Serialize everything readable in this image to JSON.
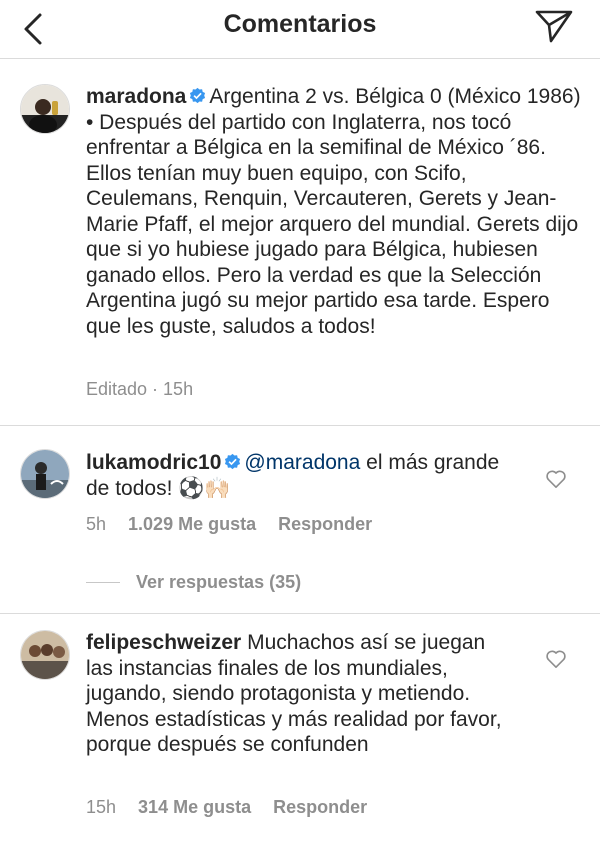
{
  "header": {
    "title": "Comentarios"
  },
  "caption": {
    "username": "maradona",
    "text": "Argentina 2 vs. Bélgica 0 (México 1986) • Después del partido con Inglaterra, nos tocó enfrentar a Bélgica en la semifinal de México ´86. Ellos tenían muy buen equipo, con Scifo, Ceulemans, Renquin, Vercauteren, Gerets y Jean-Marie Pfaff, el mejor arquero del mundial. Gerets dijo que si yo hubiese jugado para Bélgica, hubiesen ganado ellos. Pero la verdad es que la Selección Argentina jugó su mejor partido esa tarde. Espero que les guste, saludos a todos!",
    "edited": "Editado · 15h"
  },
  "comments": [
    {
      "username": "lukamodric10",
      "mention": "@maradona",
      "text": "el más grande de todos! ⚽🙌🏻",
      "time": "5h",
      "likes": "1.029 Me gusta",
      "reply": "Responder",
      "view_replies": "Ver respuestas (35)"
    },
    {
      "username": "felipeschweizer",
      "text": "Muchachos así se juegan las instancias finales de los mundiales, jugando, siendo protagonista y metiendo. Menos estadísticas y más realidad por favor, porque después se confunden",
      "time": "15h",
      "likes": "314 Me gusta",
      "reply": "Responder"
    }
  ],
  "icons": {
    "back": "chevron-left-icon",
    "send": "paper-plane-icon",
    "verified": "verified-badge-icon",
    "like": "heart-outline-icon"
  },
  "colors": {
    "verified": "#3897f0",
    "mention": "#003569",
    "meta": "#8e8e8e"
  }
}
